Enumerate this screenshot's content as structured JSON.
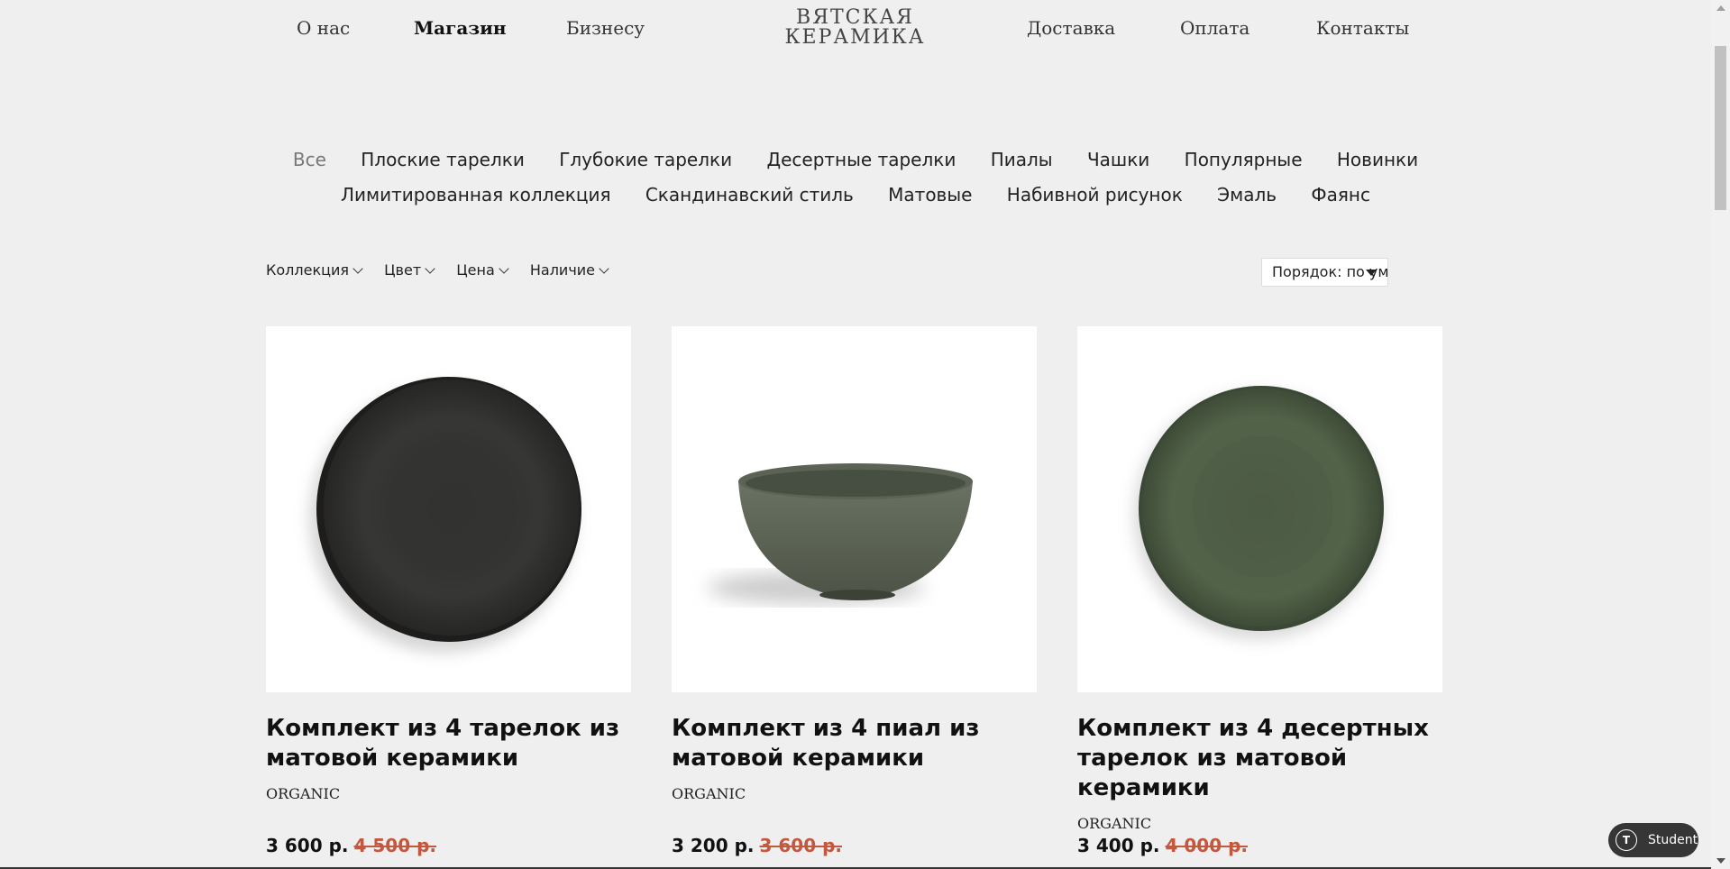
{
  "header": {
    "nav_left": [
      "О нас",
      "Магазин",
      "Бизнесу"
    ],
    "logo_line1": "ВЯТСКАЯ",
    "logo_line2": "КЕРАМИКА",
    "nav_right": [
      "Доставка",
      "Оплата",
      "Контакты"
    ],
    "active_item": "Магазин"
  },
  "categories": {
    "row1": [
      "Все",
      "Плоские тарелки",
      "Глубокие тарелки",
      "Десертные тарелки",
      "Пиалы",
      "Чашки",
      "Популярные",
      "Новинки"
    ],
    "row2": [
      "Лимитированная коллекция",
      "Скандинавский стиль",
      "Матовые",
      "Набивной рисунок",
      "Эмаль",
      "Фаянс"
    ],
    "active": "Все"
  },
  "filters": {
    "items": [
      "Коллекция",
      "Цвет",
      "Цена",
      "Наличие"
    ],
    "sort_label": "Порядок: по умолча"
  },
  "products": [
    {
      "title": "Комплект из 4 тарелок из матовой керамики",
      "brand": "ORGANIC",
      "price": "3 600 р.",
      "old_price": "4 500 р.",
      "image": "dark-matte-plate",
      "color": "#2f302d"
    },
    {
      "title": "Комплект из 4 пиал из матовой керамики",
      "brand": "ORGANIC",
      "price": "3 200 р.",
      "old_price": "3 600 р.",
      "image": "olive-matte-bowl",
      "color": "#5e6657"
    },
    {
      "title": "Комплект из 4 десертных тарелок из матовой керамики",
      "brand": "ORGANIC",
      "price": "3 400 р.",
      "old_price": "4 000 р.",
      "image": "green-matte-dessert-plate",
      "color": "#4c5c44"
    }
  ],
  "badge": {
    "label": "Student",
    "icon": "tilda-icon",
    "icon_glyph": "T"
  },
  "colors": {
    "background": "#efefef",
    "old_price": "#c2593f",
    "badge": "#363636"
  }
}
